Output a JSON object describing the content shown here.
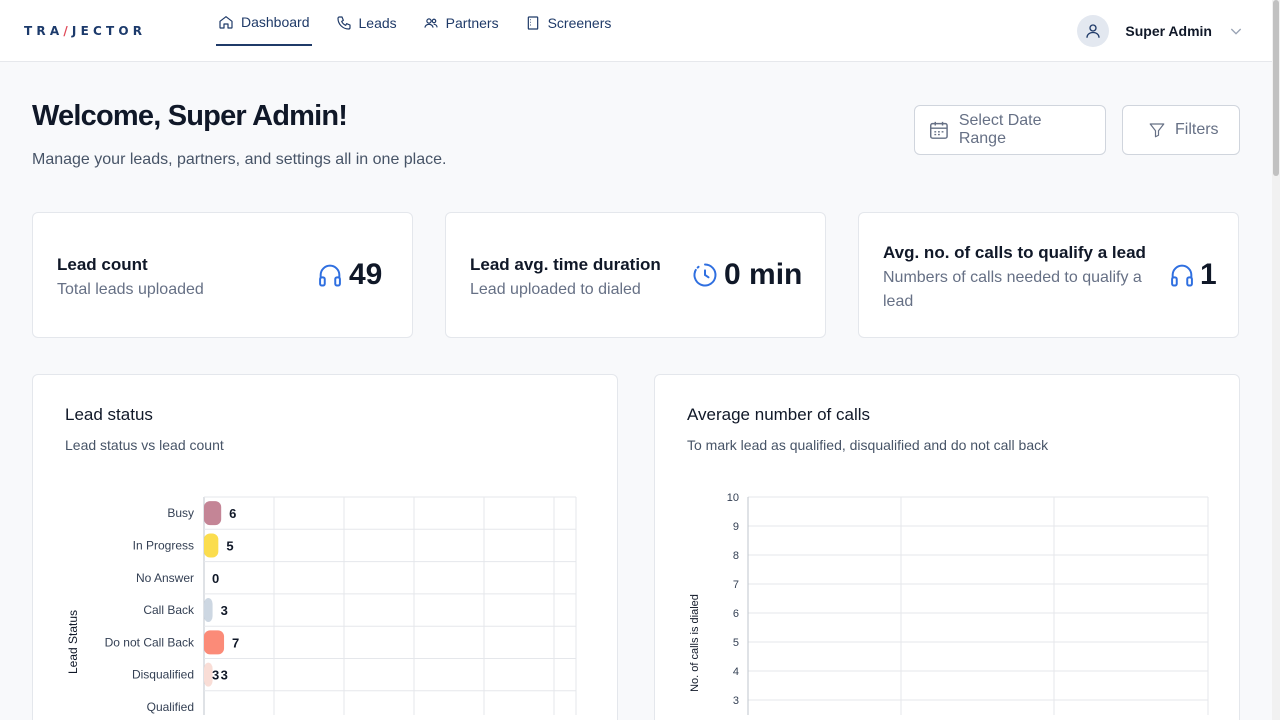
{
  "header": {
    "logo": "TRAJECTOR",
    "nav": [
      {
        "label": "Dashboard",
        "icon": "home-icon",
        "active": true
      },
      {
        "label": "Leads",
        "icon": "phone-icon",
        "active": false
      },
      {
        "label": "Partners",
        "icon": "users-icon",
        "active": false
      },
      {
        "label": "Screeners",
        "icon": "document-icon",
        "active": false
      }
    ],
    "user_name": "Super Admin"
  },
  "page": {
    "title": "Welcome, Super Admin!",
    "subtitle": "Manage your leads, partners, and settings all in one place.",
    "date_range_label": "Select Date Range",
    "filters_label": "Filters"
  },
  "cards": [
    {
      "title": "Lead count",
      "subtitle": "Total leads uploaded",
      "value": "49",
      "icon": "headphones-icon"
    },
    {
      "title": "Lead avg. time duration",
      "subtitle": "Lead uploaded to dialed",
      "value": "0 min",
      "icon": "clock-icon"
    },
    {
      "title": "Avg. no. of calls to qualify a lead",
      "subtitle": "Numbers of calls needed to qualify a lead",
      "value": "1",
      "icon": "headphones-icon"
    }
  ],
  "lead_status_panel": {
    "title": "Lead status",
    "subtitle": "Lead status vs lead count"
  },
  "avg_calls_panel": {
    "title": "Average number of calls",
    "subtitle": "To mark lead as qualified, disqualified and do not call back"
  },
  "colors": {
    "primary": "#1f3a68",
    "accent": "#2f6fe0"
  },
  "chart_data": [
    {
      "type": "bar",
      "orientation": "horizontal",
      "ylabel": "Lead Status",
      "xlim": [
        0,
        50
      ],
      "grid": true,
      "categories": [
        "Busy",
        "In Progress",
        "No Answer",
        "Call Back",
        "Do not Call Back",
        "Disqualified",
        "Qualified"
      ],
      "values": [
        6,
        5,
        0,
        3,
        7,
        3,
        null
      ],
      "colors": [
        "#c48596",
        "#fbdd4e",
        "#cccccc",
        "#cdd7e2",
        "#fb8b78",
        "#f9ddd6",
        "#cccccc"
      ],
      "data_labels": [
        "6",
        "5",
        "0",
        "3",
        "7",
        "3",
        ""
      ],
      "extra_labels": [
        {
          "category": "Disqualified",
          "text": "3"
        }
      ]
    },
    {
      "type": "line",
      "ylabel": "No. of calls is dialed",
      "yticks": [
        3,
        4,
        5,
        6,
        7,
        8,
        9,
        10
      ],
      "ylim_visible": [
        3,
        10
      ],
      "grid": true,
      "series": []
    }
  ]
}
